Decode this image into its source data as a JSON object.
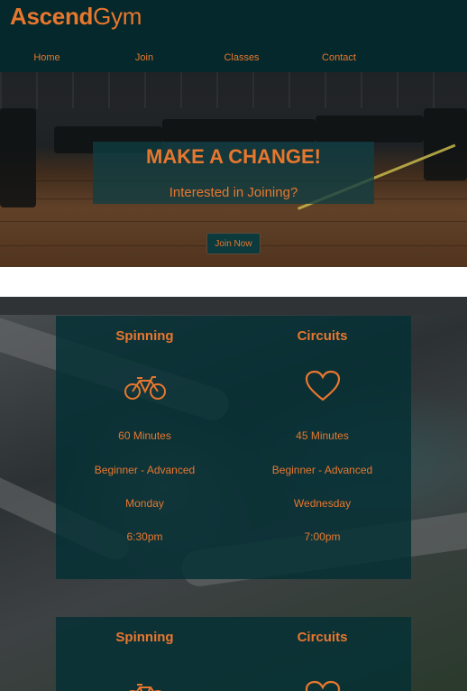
{
  "brand": {
    "part1": "Ascend",
    "part2": "Gym"
  },
  "nav": [
    {
      "label": "Home"
    },
    {
      "label": "Join"
    },
    {
      "label": "Classes"
    },
    {
      "label": "Contact"
    }
  ],
  "hero": {
    "title": "MAKE A CHANGE!",
    "subtitle": "Interested in Joining?",
    "button_label": "Join Now"
  },
  "classes": [
    {
      "name": "Spinning",
      "icon": "bicycle-icon",
      "duration": "60 Minutes",
      "level": "Beginner - Advanced",
      "day": "Monday",
      "time": "6:30pm"
    },
    {
      "name": "Circuits",
      "icon": "heart-icon",
      "duration": "45 Minutes",
      "level": "Beginner - Advanced",
      "day": "Wednesday",
      "time": "7:00pm"
    },
    {
      "name": "Spinning",
      "icon": "bicycle-icon"
    },
    {
      "name": "Circuits",
      "icon": "heart-icon"
    }
  ],
  "colors": {
    "accent": "#e8772e",
    "header_bg": "#04282b",
    "card_bg": "#04343a"
  }
}
